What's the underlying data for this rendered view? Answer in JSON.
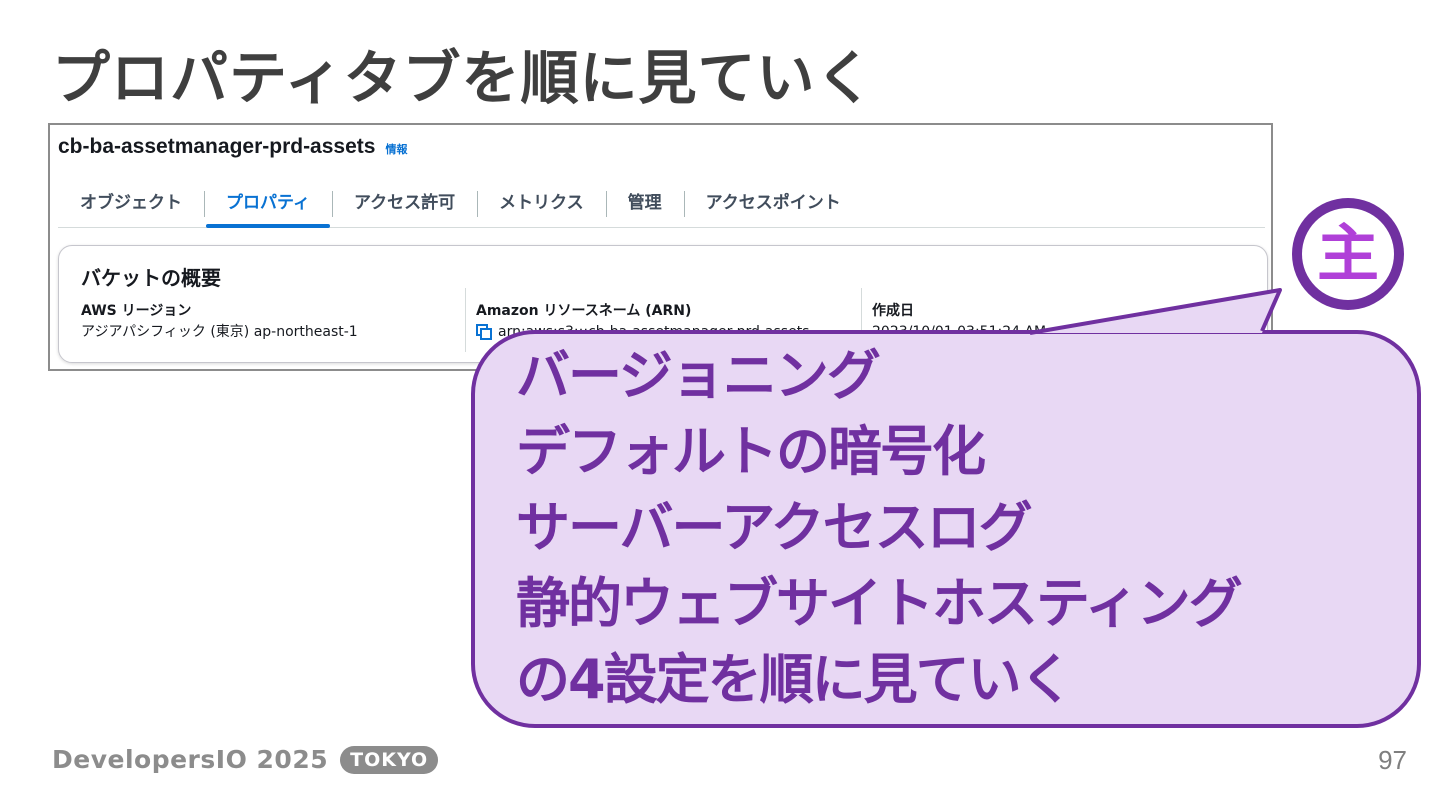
{
  "slide": {
    "title": "プロパティタブを順に見ていく",
    "page_number": "97"
  },
  "console": {
    "bucket_name": "cb-ba-assetmanager-prd-assets",
    "info_label": "情報",
    "tabs": [
      {
        "label": "オブジェクト",
        "active": false
      },
      {
        "label": "プロパティ",
        "active": true
      },
      {
        "label": "アクセス許可",
        "active": false
      },
      {
        "label": "メトリクス",
        "active": false
      },
      {
        "label": "管理",
        "active": false
      },
      {
        "label": "アクセスポイント",
        "active": false
      }
    ],
    "overview": {
      "title": "バケットの概要",
      "region_label": "AWS リージョン",
      "region_value": "アジアパシフィック (東京) ap-northeast-1",
      "arn_label": "Amazon リソースネーム (ARN)",
      "arn_value": "arn:aws:s3:::cb-ba-assetmanager-prd-assets",
      "created_label": "作成日",
      "created_value": "2023/10/01 03:51:24 AM"
    }
  },
  "callout": {
    "lines": [
      "バージョニング",
      "デフォルトの暗号化",
      "サーバーアクセスログ",
      "静的ウェブサイトホスティング",
      "の4設定を順に見ていく"
    ],
    "fill_color": "#e8d8f4",
    "border_color": "#7030a0"
  },
  "avatar": {
    "glyph": "主",
    "color": "#b040d8"
  },
  "footer": {
    "brand": "DevelopersIO 2025",
    "badge": "TOKYO"
  }
}
